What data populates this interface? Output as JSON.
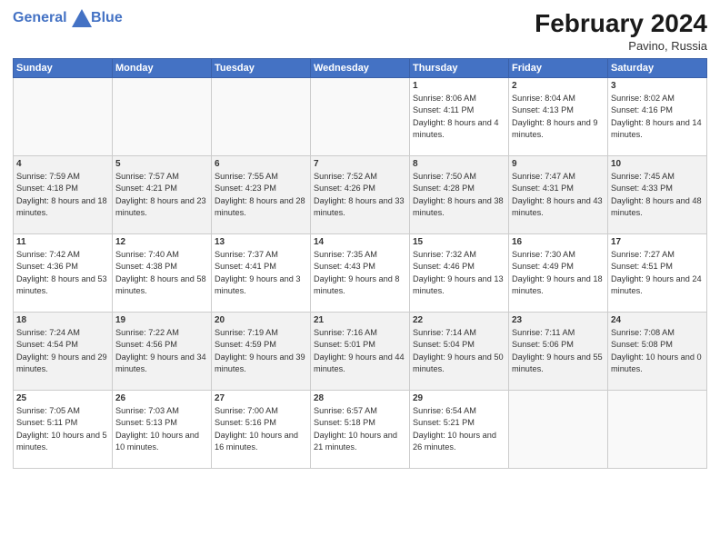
{
  "header": {
    "logo_line1": "General",
    "logo_line2": "Blue",
    "month_title": "February 2024",
    "location": "Pavino, Russia"
  },
  "days_of_week": [
    "Sunday",
    "Monday",
    "Tuesday",
    "Wednesday",
    "Thursday",
    "Friday",
    "Saturday"
  ],
  "weeks": [
    [
      {
        "day": "",
        "sunrise": "",
        "sunset": "",
        "daylight": "",
        "empty": true
      },
      {
        "day": "",
        "sunrise": "",
        "sunset": "",
        "daylight": "",
        "empty": true
      },
      {
        "day": "",
        "sunrise": "",
        "sunset": "",
        "daylight": "",
        "empty": true
      },
      {
        "day": "",
        "sunrise": "",
        "sunset": "",
        "daylight": "",
        "empty": true
      },
      {
        "day": "1",
        "sunrise": "Sunrise: 8:06 AM",
        "sunset": "Sunset: 4:11 PM",
        "daylight": "Daylight: 8 hours and 4 minutes."
      },
      {
        "day": "2",
        "sunrise": "Sunrise: 8:04 AM",
        "sunset": "Sunset: 4:13 PM",
        "daylight": "Daylight: 8 hours and 9 minutes."
      },
      {
        "day": "3",
        "sunrise": "Sunrise: 8:02 AM",
        "sunset": "Sunset: 4:16 PM",
        "daylight": "Daylight: 8 hours and 14 minutes."
      }
    ],
    [
      {
        "day": "4",
        "sunrise": "Sunrise: 7:59 AM",
        "sunset": "Sunset: 4:18 PM",
        "daylight": "Daylight: 8 hours and 18 minutes."
      },
      {
        "day": "5",
        "sunrise": "Sunrise: 7:57 AM",
        "sunset": "Sunset: 4:21 PM",
        "daylight": "Daylight: 8 hours and 23 minutes."
      },
      {
        "day": "6",
        "sunrise": "Sunrise: 7:55 AM",
        "sunset": "Sunset: 4:23 PM",
        "daylight": "Daylight: 8 hours and 28 minutes."
      },
      {
        "day": "7",
        "sunrise": "Sunrise: 7:52 AM",
        "sunset": "Sunset: 4:26 PM",
        "daylight": "Daylight: 8 hours and 33 minutes."
      },
      {
        "day": "8",
        "sunrise": "Sunrise: 7:50 AM",
        "sunset": "Sunset: 4:28 PM",
        "daylight": "Daylight: 8 hours and 38 minutes."
      },
      {
        "day": "9",
        "sunrise": "Sunrise: 7:47 AM",
        "sunset": "Sunset: 4:31 PM",
        "daylight": "Daylight: 8 hours and 43 minutes."
      },
      {
        "day": "10",
        "sunrise": "Sunrise: 7:45 AM",
        "sunset": "Sunset: 4:33 PM",
        "daylight": "Daylight: 8 hours and 48 minutes."
      }
    ],
    [
      {
        "day": "11",
        "sunrise": "Sunrise: 7:42 AM",
        "sunset": "Sunset: 4:36 PM",
        "daylight": "Daylight: 8 hours and 53 minutes."
      },
      {
        "day": "12",
        "sunrise": "Sunrise: 7:40 AM",
        "sunset": "Sunset: 4:38 PM",
        "daylight": "Daylight: 8 hours and 58 minutes."
      },
      {
        "day": "13",
        "sunrise": "Sunrise: 7:37 AM",
        "sunset": "Sunset: 4:41 PM",
        "daylight": "Daylight: 9 hours and 3 minutes."
      },
      {
        "day": "14",
        "sunrise": "Sunrise: 7:35 AM",
        "sunset": "Sunset: 4:43 PM",
        "daylight": "Daylight: 9 hours and 8 minutes."
      },
      {
        "day": "15",
        "sunrise": "Sunrise: 7:32 AM",
        "sunset": "Sunset: 4:46 PM",
        "daylight": "Daylight: 9 hours and 13 minutes."
      },
      {
        "day": "16",
        "sunrise": "Sunrise: 7:30 AM",
        "sunset": "Sunset: 4:49 PM",
        "daylight": "Daylight: 9 hours and 18 minutes."
      },
      {
        "day": "17",
        "sunrise": "Sunrise: 7:27 AM",
        "sunset": "Sunset: 4:51 PM",
        "daylight": "Daylight: 9 hours and 24 minutes."
      }
    ],
    [
      {
        "day": "18",
        "sunrise": "Sunrise: 7:24 AM",
        "sunset": "Sunset: 4:54 PM",
        "daylight": "Daylight: 9 hours and 29 minutes."
      },
      {
        "day": "19",
        "sunrise": "Sunrise: 7:22 AM",
        "sunset": "Sunset: 4:56 PM",
        "daylight": "Daylight: 9 hours and 34 minutes."
      },
      {
        "day": "20",
        "sunrise": "Sunrise: 7:19 AM",
        "sunset": "Sunset: 4:59 PM",
        "daylight": "Daylight: 9 hours and 39 minutes."
      },
      {
        "day": "21",
        "sunrise": "Sunrise: 7:16 AM",
        "sunset": "Sunset: 5:01 PM",
        "daylight": "Daylight: 9 hours and 44 minutes."
      },
      {
        "day": "22",
        "sunrise": "Sunrise: 7:14 AM",
        "sunset": "Sunset: 5:04 PM",
        "daylight": "Daylight: 9 hours and 50 minutes."
      },
      {
        "day": "23",
        "sunrise": "Sunrise: 7:11 AM",
        "sunset": "Sunset: 5:06 PM",
        "daylight": "Daylight: 9 hours and 55 minutes."
      },
      {
        "day": "24",
        "sunrise": "Sunrise: 7:08 AM",
        "sunset": "Sunset: 5:08 PM",
        "daylight": "Daylight: 10 hours and 0 minutes."
      }
    ],
    [
      {
        "day": "25",
        "sunrise": "Sunrise: 7:05 AM",
        "sunset": "Sunset: 5:11 PM",
        "daylight": "Daylight: 10 hours and 5 minutes."
      },
      {
        "day": "26",
        "sunrise": "Sunrise: 7:03 AM",
        "sunset": "Sunset: 5:13 PM",
        "daylight": "Daylight: 10 hours and 10 minutes."
      },
      {
        "day": "27",
        "sunrise": "Sunrise: 7:00 AM",
        "sunset": "Sunset: 5:16 PM",
        "daylight": "Daylight: 10 hours and 16 minutes."
      },
      {
        "day": "28",
        "sunrise": "Sunrise: 6:57 AM",
        "sunset": "Sunset: 5:18 PM",
        "daylight": "Daylight: 10 hours and 21 minutes."
      },
      {
        "day": "29",
        "sunrise": "Sunrise: 6:54 AM",
        "sunset": "Sunset: 5:21 PM",
        "daylight": "Daylight: 10 hours and 26 minutes."
      },
      {
        "day": "",
        "sunrise": "",
        "sunset": "",
        "daylight": "",
        "empty": true
      },
      {
        "day": "",
        "sunrise": "",
        "sunset": "",
        "daylight": "",
        "empty": true
      }
    ]
  ]
}
